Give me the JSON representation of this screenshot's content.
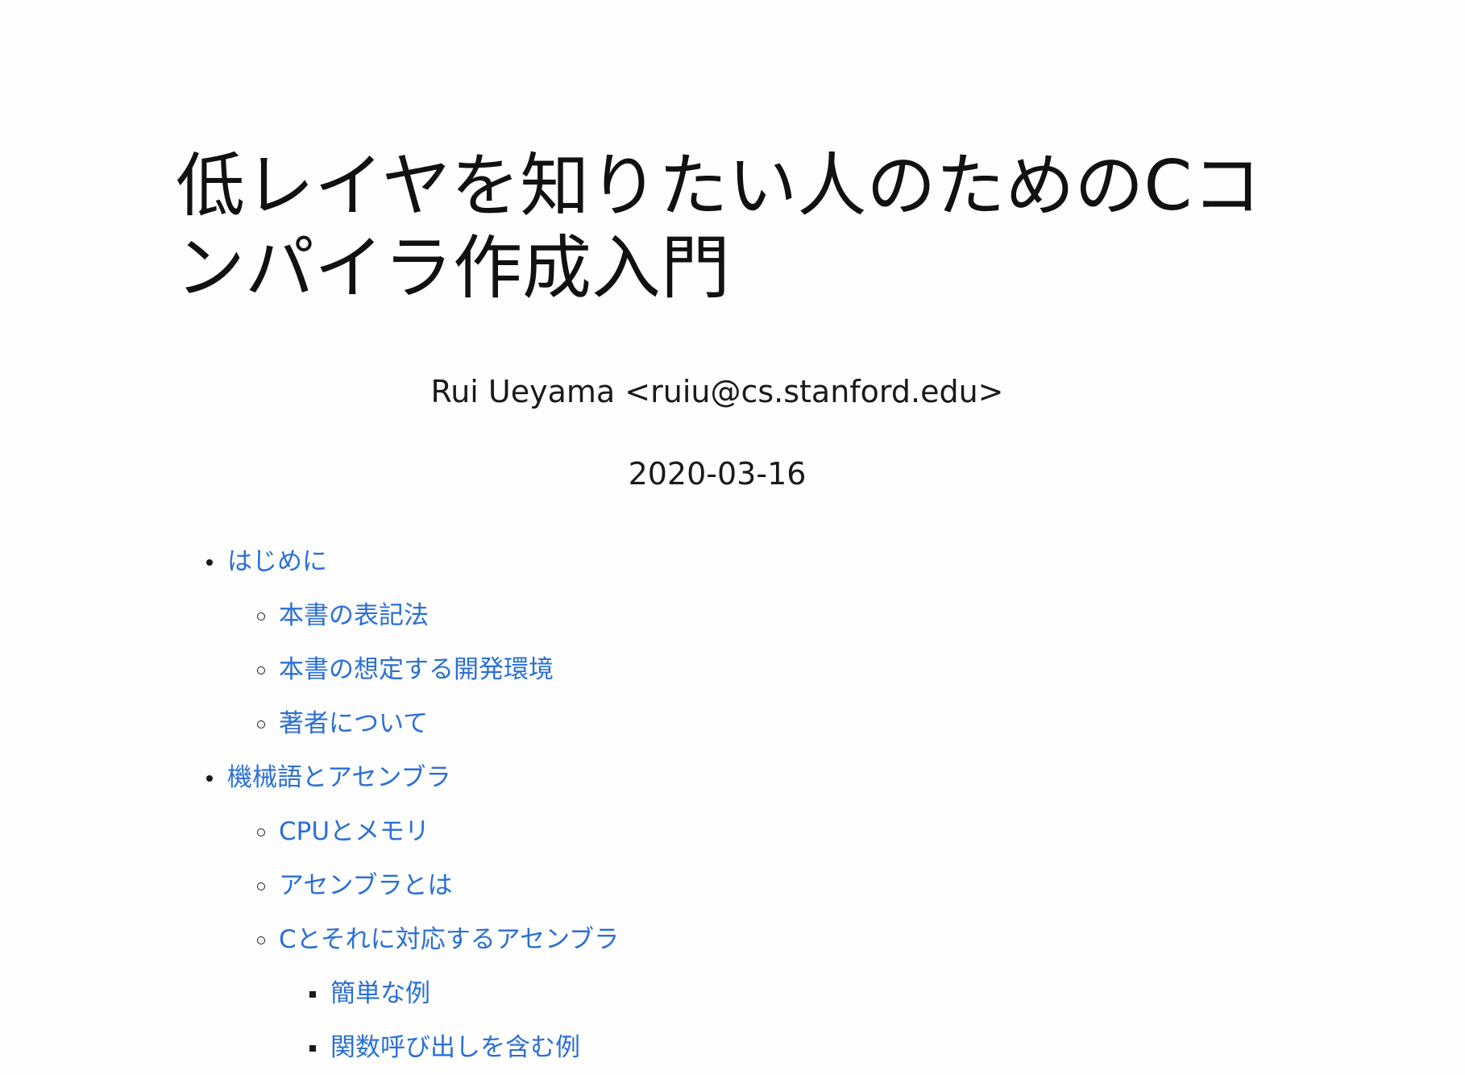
{
  "document": {
    "title": "低レイヤを知りたい人のためのCコンパイラ作成入門",
    "author": "Rui Ueyama <ruiu@cs.stanford.edu>",
    "date": "2020-03-16"
  },
  "toc": [
    {
      "label": "はじめに",
      "level": 1
    },
    {
      "label": "本書の表記法",
      "level": 2
    },
    {
      "label": "本書の想定する開発環境",
      "level": 2
    },
    {
      "label": "著者について",
      "level": 2
    },
    {
      "label": "機械語とアセンブラ",
      "level": 1
    },
    {
      "label": "CPUとメモリ",
      "level": 2
    },
    {
      "label": "アセンブラとは",
      "level": 2
    },
    {
      "label": "Cとそれに対応するアセンブラ",
      "level": 2
    },
    {
      "label": "簡単な例",
      "level": 3
    },
    {
      "label": "関数呼び出しを含む例",
      "level": 3
    }
  ],
  "colors": {
    "link": "#2a6fd6",
    "text": "#1a1a1a",
    "background": "#fefefe"
  }
}
